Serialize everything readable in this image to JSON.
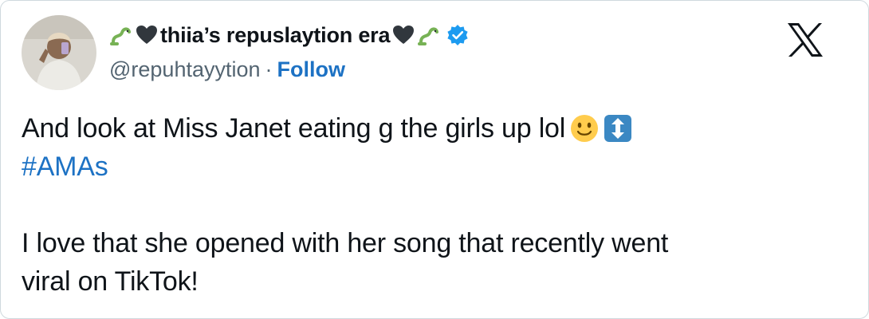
{
  "post": {
    "author": {
      "display_name": "thiia’s repuslaytion era",
      "handle": "@repuhtayytion",
      "separator": "·",
      "follow_label": "Follow",
      "name_emojis": [
        "snake-emoji",
        "black-heart-emoji",
        "black-heart-emoji",
        "snake-emoji"
      ],
      "verified_icon": "verified-badge-icon"
    },
    "text": {
      "line1": "And look at Miss Janet eating g the girls up lol",
      "line1_emojis": [
        "slightly-smiling-face-emoji",
        "up-down-arrow-emoji"
      ],
      "hashtag": "#AMAs",
      "line3": "I love that she opened with her song that recently went",
      "line4": "viral on TikTok!"
    },
    "platform_icon": "x-logo-icon"
  },
  "colors": {
    "link": "#1d72c4",
    "secondary_text": "#536471",
    "verified": "#1d9bf0",
    "border": "#cfd9de"
  }
}
